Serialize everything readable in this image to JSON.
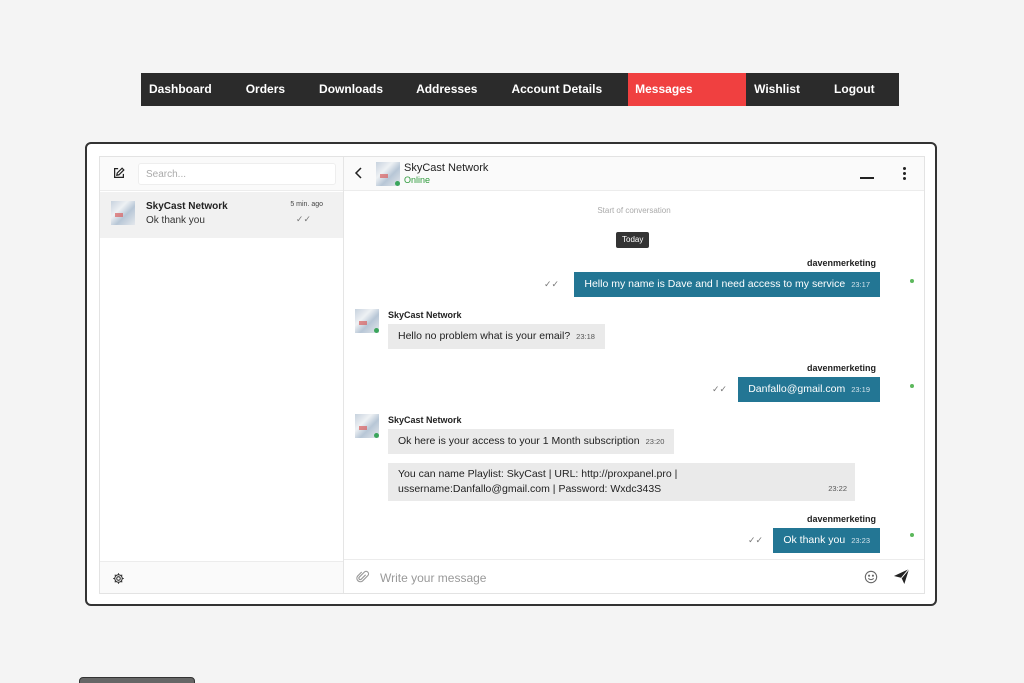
{
  "nav": {
    "items": [
      {
        "label": "Dashboard"
      },
      {
        "label": "Orders"
      },
      {
        "label": "Downloads"
      },
      {
        "label": "Addresses"
      },
      {
        "label": "Account Details"
      },
      {
        "label": "Messages",
        "active": true
      },
      {
        "label": "Wishlist"
      },
      {
        "label": "Logout"
      }
    ]
  },
  "sidebar": {
    "search_placeholder": "Search...",
    "conversations": [
      {
        "name": "SkyCast Network",
        "last_message": "Ok thank you",
        "time": "5 min. ago",
        "status_icon": "double-check-icon"
      }
    ]
  },
  "chat": {
    "contact_name": "SkyCast Network",
    "contact_status": "Online",
    "start_label": "Start of conversation",
    "day_label": "Today",
    "messages": [
      {
        "sender": "davenmerketing",
        "text": "Hello my name is Dave and I need access to my service",
        "time": "23:17"
      },
      {
        "sender": "SkyCast Network",
        "text": "Hello no problem what is your email?",
        "time": "23:18"
      },
      {
        "sender": "davenmerketing",
        "text": "Danfallo@gmail.com",
        "time": "23:19"
      },
      {
        "sender": "SkyCast Network",
        "text": "Ok here is your access to your 1 Month subscription",
        "time": "23:20"
      },
      {
        "sender": "SkyCast Network",
        "text_line1": "You can name Playlist: SkyCast | URL: http://proxpanel.pro |",
        "text_line2": "ussername:Danfallo@gmail.com | Password: Wxdc343S",
        "time": "23:22"
      },
      {
        "sender": "davenmerketing",
        "text": "Ok thank you",
        "time": "23:23"
      }
    ],
    "input_placeholder": "Write your message"
  },
  "colors": {
    "nav_bg": "#2b2b2b",
    "nav_active": "#f04040",
    "outgoing_bubble": "#237694",
    "incoming_bubble": "#eaeaea",
    "online": "#2d9a3a"
  }
}
